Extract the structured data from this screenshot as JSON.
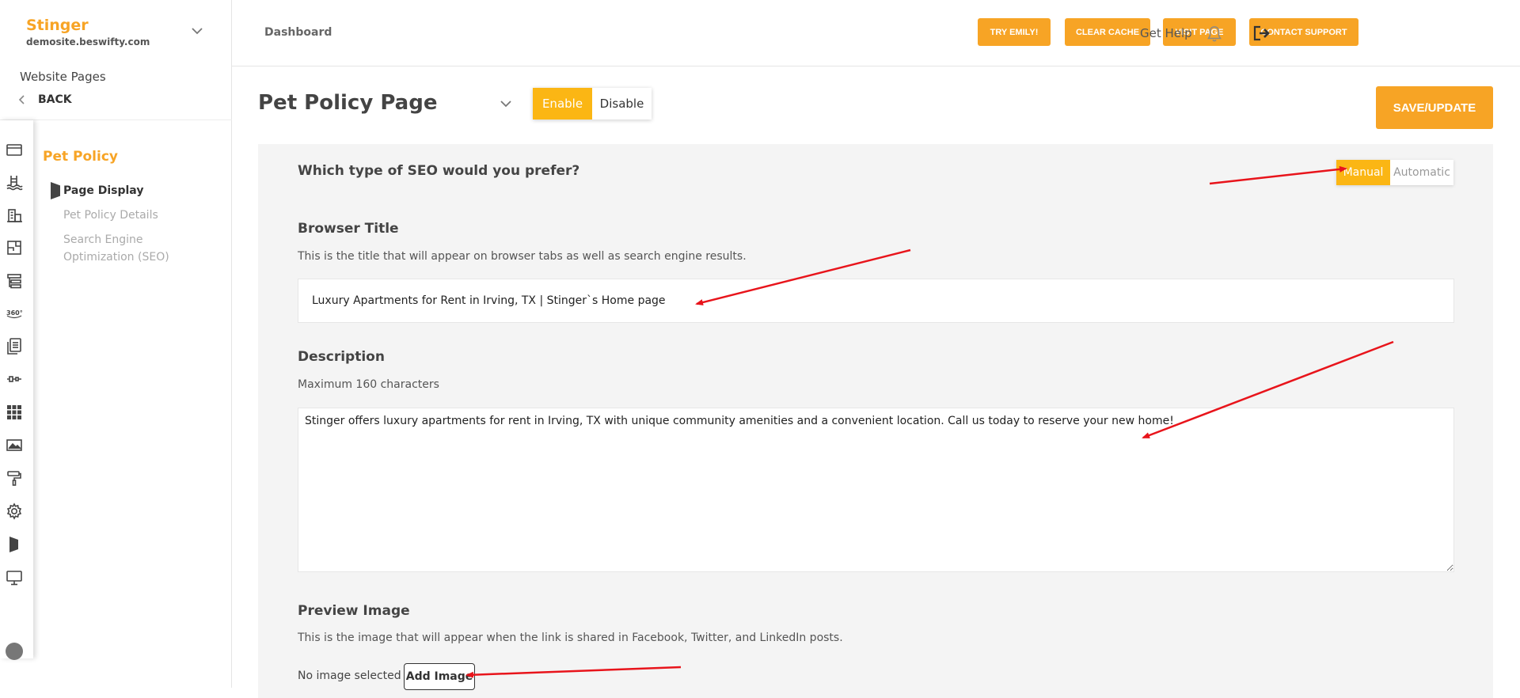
{
  "site": {
    "name": "Stinger",
    "domain": "demosite.beswifty.com"
  },
  "sidebar": {
    "section_title": "Website Pages",
    "back_label": "BACK",
    "page_title": "Pet Policy",
    "nav": [
      {
        "label": "Page Display",
        "active": true
      },
      {
        "label": "Pet Policy Details",
        "active": false
      },
      {
        "label": "Search Engine Optimization (SEO)",
        "active": false
      }
    ],
    "rail_icons": [
      "browser-window-icon",
      "pool-icon",
      "buildings-icon",
      "floorplan-icon",
      "sitemap-icon",
      "360-view-icon",
      "documents-icon",
      "slider-icon",
      "grid-icon",
      "image-icon",
      "paint-roller-icon",
      "gear-icon",
      "flag-icon",
      "monitor-icon"
    ]
  },
  "topbar": {
    "breadcrumb": "Dashboard",
    "buttons": {
      "try_emily": "TRY EMILY!",
      "clear_cache": "CLEAR CACHE",
      "visit_page": "VISIT PAGE",
      "contact_support": "CONTACT SUPPORT"
    },
    "get_help": "Get Help"
  },
  "main": {
    "page_title": "Pet Policy Page",
    "enable_label": "Enable",
    "disable_label": "Disable",
    "save_label": "SAVE/UPDATE",
    "seo_question": "Which type of SEO would you prefer?",
    "seo_manual": "Manual",
    "seo_automatic": "Automatic",
    "browser_title_label": "Browser Title",
    "browser_title_hint": "This is the title that will appear on browser tabs as well as search engine results.",
    "browser_title_value": "Luxury Apartments for Rent in Irving, TX | Stinger`s Home page",
    "description_label": "Description",
    "description_hint": "Maximum 160 characters",
    "description_value": "Stinger offers luxury apartments for rent in Irving, TX with unique community amenities and a convenient location. Call us today to reserve your new home!",
    "preview_label": "Preview Image",
    "preview_hint": "This is the image that will appear when the link is shared in Facebook, Twitter, and LinkedIn posts.",
    "no_image_text": "No image selected",
    "add_image_label": "Add Image"
  },
  "colors": {
    "accent": "#f7a425",
    "toggle_active": "#fbb614",
    "annotation": "#e8141b"
  }
}
